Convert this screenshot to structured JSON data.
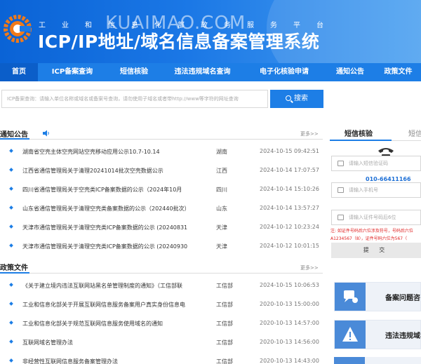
{
  "header": {
    "subtitle": "工业和信息化部政务服务平台",
    "title": "ICP/IP地址/域名信息备案管理系统",
    "watermark": "KUAIMAO.COM"
  },
  "nav": {
    "items": [
      {
        "label": "首页",
        "active": true
      },
      {
        "label": "ICP备案查询"
      },
      {
        "label": "短信核验"
      },
      {
        "label": "违法违规域名查询"
      },
      {
        "label": "电子化核验申请"
      },
      {
        "label": "通知公告"
      },
      {
        "label": "政策文件"
      }
    ]
  },
  "search": {
    "placeholder": "ICP备案查询：请输入单位名称或域名或备案号查询，请勿使用子域名或者带http://www等字符的网址查询",
    "button_label": "搜索"
  },
  "notices": {
    "title": "通知公告",
    "more": "更多>>",
    "rows": [
      {
        "title": "湖南省空壳主体空壳网站空壳移动应用公示10.7-10.14",
        "region": "湖南",
        "date": "2024-10-15 09:42:51"
      },
      {
        "title": "江西省通信管理局关于清理20241014批次空壳数据公示",
        "region": "江西",
        "date": "2024-10-14 17:07:57"
      },
      {
        "title": "四川省通信管理局关于空壳类ICP备案数据的公示（2024年10月",
        "region": "四川",
        "date": "2024-10-14 15:10:26"
      },
      {
        "title": "山东省通信管理局关于清理空壳类备案数据的公示（202440批次）",
        "region": "山东",
        "date": "2024-10-14 13:57:27"
      },
      {
        "title": "天津市通信管理局关于清理空壳类ICP备案数据的公示 (20240831",
        "region": "天津",
        "date": "2024-10-12 10:23:24"
      },
      {
        "title": "天津市通信管理局关于清理空壳类ICP备案数据的公示 (20240930",
        "region": "天津",
        "date": "2024-10-12 10:01:15"
      }
    ]
  },
  "policies": {
    "title": "政策文件",
    "more": "更多>>",
    "rows": [
      {
        "title": "《关于建立境内违法互联网站黑名单管理制度的通知》（工信部联",
        "region": "工信部",
        "date": "2024-10-15 10:06:53"
      },
      {
        "title": "工业和信息化部关于开展互联网信息服务备案用户真实身份信息电",
        "region": "工信部",
        "date": "2020-10-13 15:00:00"
      },
      {
        "title": "工业和信息化部关于规范互联网信息服务使用域名的通知",
        "region": "工信部",
        "date": "2020-10-13 14:57:00"
      },
      {
        "title": "互联网域名管理办法",
        "region": "工信部",
        "date": "2020-10-13 14:56:00"
      },
      {
        "title": "非经营性互联网信息服务备案管理办法",
        "region": "工信部",
        "date": "2020-10-13 14:43:00"
      }
    ]
  },
  "sms_panel": {
    "tab_active": "短信核验",
    "tab_next": "短信",
    "code_placeholder": "请输入短信验证码",
    "hotline": "010-66411166",
    "phone_placeholder": "请输入手机号",
    "id_placeholder": "请输入证件号码后6位",
    "note_line1": "注: 如证件号码后六位涉及符号，号码后六位",
    "note_line2": "A1234567（8），证件号码六位为567（",
    "submit_label": "提 交"
  },
  "quick_links": [
    {
      "label": "备案问题咨",
      "icon": "chat-icon"
    },
    {
      "label": "违法违规域名",
      "icon": "warning-icon"
    }
  ],
  "colors": {
    "brand_blue": "#1d7ee6",
    "nav_active": "#0b5ec9",
    "warning_red": "#e02020"
  }
}
